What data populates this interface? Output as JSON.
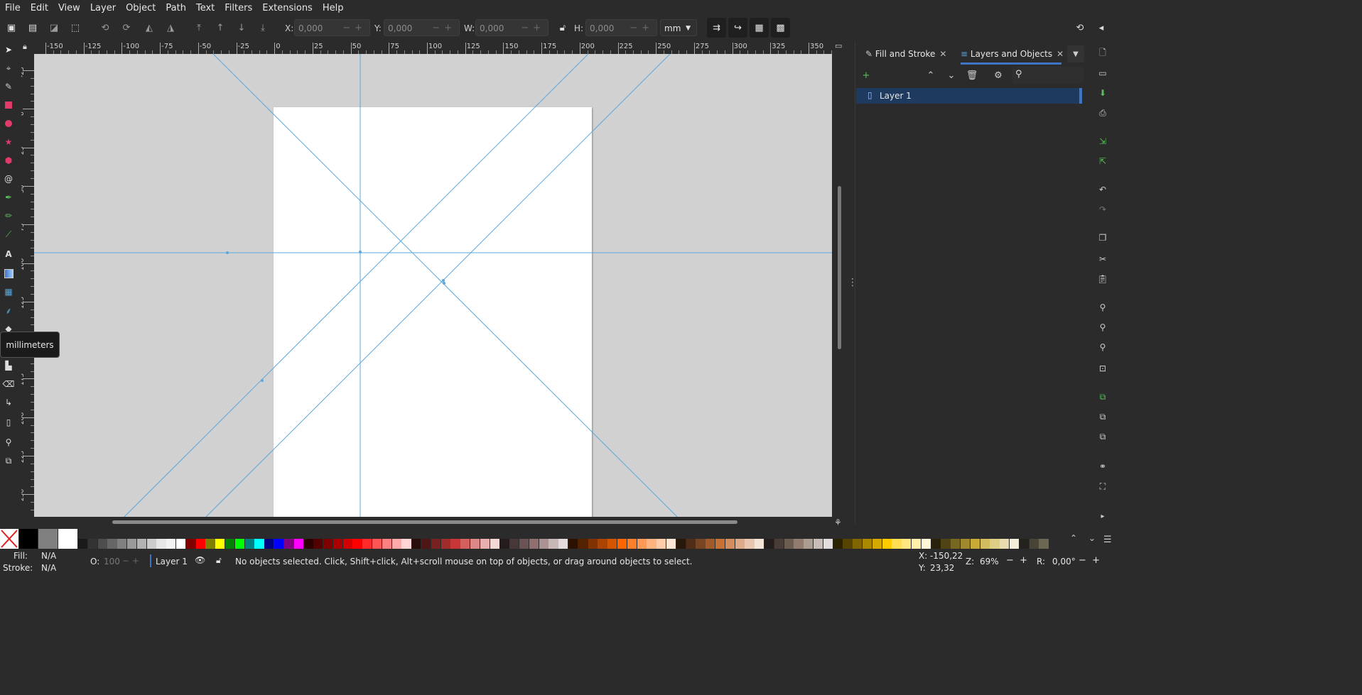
{
  "menu": [
    "File",
    "Edit",
    "View",
    "Layer",
    "Object",
    "Path",
    "Text",
    "Filters",
    "Extensions",
    "Help"
  ],
  "toolbar": {
    "x_label": "X:",
    "x_value": "0,000",
    "y_label": "Y:",
    "y_value": "0,000",
    "w_label": "W:",
    "w_value": "0,000",
    "h_label": "H:",
    "h_value": "0,000",
    "unit": "mm"
  },
  "ruler": {
    "h_ticks": [
      "-150",
      "-125",
      "-100",
      "-75",
      "-50",
      "-25",
      "0",
      "25",
      "50",
      "75",
      "100",
      "125",
      "150",
      "175",
      "200",
      "225",
      "250",
      "275",
      "300",
      "325",
      "350"
    ],
    "v_ticks": [
      "-25",
      "0",
      "25",
      "50",
      "75",
      "100",
      "125",
      "150",
      "175",
      "200",
      "225",
      "250"
    ]
  },
  "tooltip": "millimeters",
  "dock": {
    "tabs": [
      {
        "label": "Fill and Stroke",
        "icon": "fill-stroke-icon"
      },
      {
        "label": "Layers and Objects",
        "icon": "layers-icon"
      }
    ],
    "layers": [
      {
        "label": "Layer 1"
      }
    ]
  },
  "status": {
    "fill_label": "Fill:",
    "fill_value": "N/A",
    "stroke_label": "Stroke:",
    "stroke_value": "N/A",
    "opacity_label": "O:",
    "opacity_value": "100",
    "layer": "Layer 1",
    "message": "No objects selected. Click, Shift+click, Alt+scroll mouse on top of objects, or drag around objects to select.",
    "x_label": "X:",
    "x_value": "-150,22",
    "y_label": "Y:",
    "y_value": "23,32",
    "zoom_label": "Z:",
    "zoom_value": "69%",
    "rotation_label": "R:",
    "rotation_value": "0,00°"
  },
  "colors": {
    "guide": "#5aa8dc",
    "accent": "#3d74c4",
    "canvas": "#d1d1d1",
    "page": "#ffffff"
  }
}
